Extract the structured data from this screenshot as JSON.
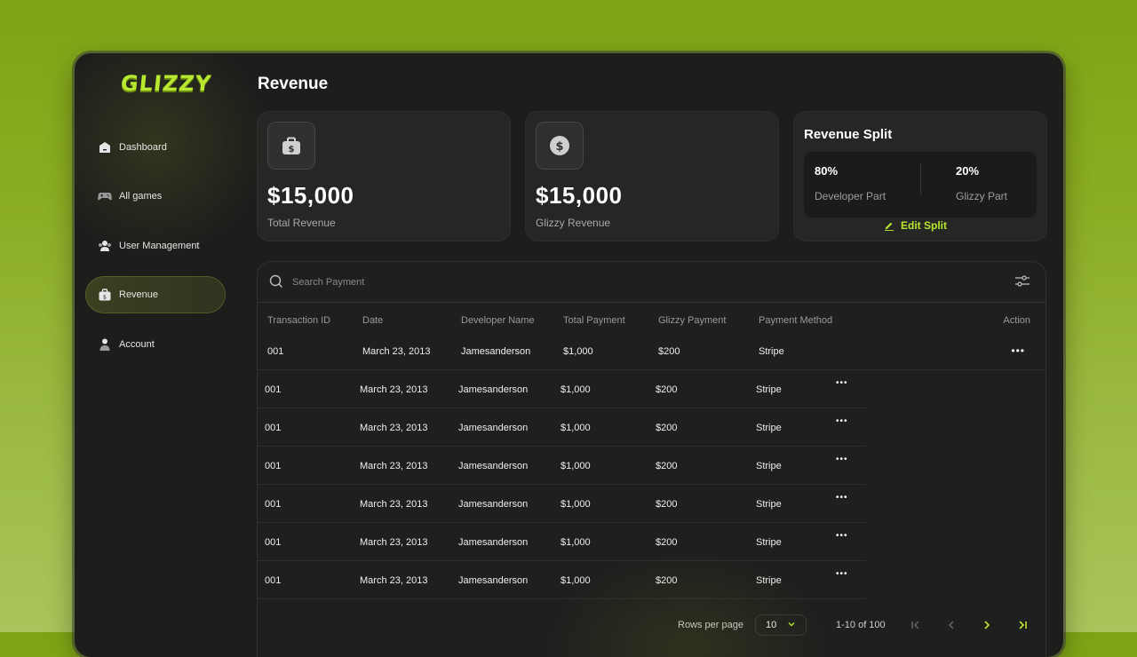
{
  "brand": {
    "logo": "GLIZZY",
    "accent": "#b8e830"
  },
  "sidebar": {
    "items": [
      {
        "label": "Dashboard",
        "icon": "home-icon"
      },
      {
        "label": "All games",
        "icon": "gamepad-icon"
      },
      {
        "label": "User Management",
        "icon": "users-icon"
      },
      {
        "label": "Revenue",
        "icon": "briefcase-icon",
        "active": true
      },
      {
        "label": "Account",
        "icon": "user-icon"
      }
    ]
  },
  "page": {
    "title": "Revenue"
  },
  "cards": {
    "total": {
      "amount": "$15,000",
      "caption": "Total Revenue",
      "icon": "briefcase-dollar-icon"
    },
    "glizzy": {
      "amount": "$15,000",
      "caption": "Glizzy Revenue",
      "icon": "dollar-coin-icon"
    },
    "split": {
      "title": "Revenue Split",
      "developer_pct": "80%",
      "developer_label": "Developer Part",
      "glizzy_pct": "20%",
      "glizzy_label": "Glizzy Part",
      "edit_label": "Edit Split"
    }
  },
  "table": {
    "search_placeholder": "Search Payment",
    "headers": [
      "Transaction ID",
      "Date",
      "Developer Name",
      "Total Payment",
      "Glizzy Payment",
      "Payment Method",
      "Action"
    ],
    "rows": [
      [
        "001",
        "March 23, 2013",
        "Jamesanderson",
        "$1,000",
        "$200",
        "Stripe"
      ],
      [
        "001",
        "March 23, 2013",
        "Jamesanderson",
        "$1,000",
        "$200",
        "Stripe"
      ],
      [
        "001",
        "March 23, 2013",
        "Jamesanderson",
        "$1,000",
        "$200",
        "Stripe"
      ],
      [
        "001",
        "March 23, 2013",
        "Jamesanderson",
        "$1,000",
        "$200",
        "Stripe"
      ],
      [
        "001",
        "March 23, 2013",
        "Jamesanderson",
        "$1,000",
        "$200",
        "Stripe"
      ],
      [
        "001",
        "March 23, 2013",
        "Jamesanderson",
        "$1,000",
        "$200",
        "Stripe"
      ],
      [
        "001",
        "March 23, 2013",
        "Jamesanderson",
        "$1,000",
        "$200",
        "Stripe"
      ]
    ],
    "action_glyph": "•••"
  },
  "pagination": {
    "rows_per_page_label": "Rows per page",
    "rows_per_page_value": "10",
    "range_text": "1-10 of 100"
  }
}
